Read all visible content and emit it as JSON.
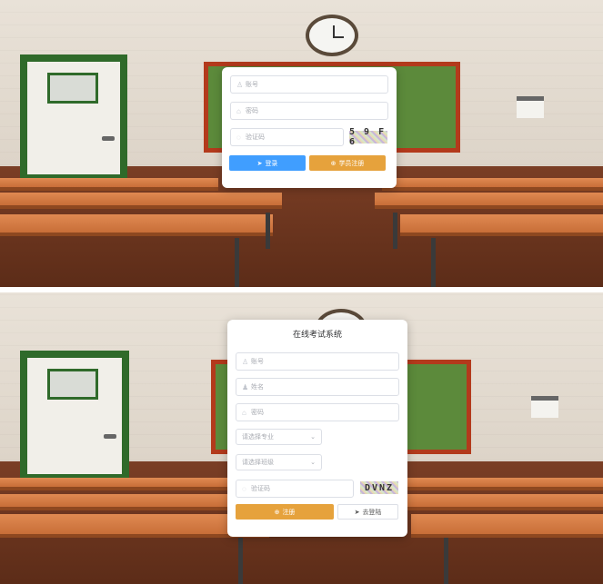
{
  "login": {
    "account_placeholder": "账号",
    "password_placeholder": "密码",
    "captcha_placeholder": "验证码",
    "captcha_text": "5 9 F 6",
    "login_button": "登录",
    "register_button": "学员注册",
    "icons": {
      "account": "user-icon",
      "password": "lock-icon",
      "captcha": "shield-icon",
      "login": "send-icon",
      "register": "plus-circle-icon"
    }
  },
  "register": {
    "title": "在线考试系统",
    "account_placeholder": "账号",
    "name_placeholder": "姓名",
    "password_placeholder": "密码",
    "major_placeholder": "请选择专业",
    "class_placeholder": "请选择班级",
    "captcha_placeholder": "验证码",
    "captcha_text": "DVNZ",
    "register_button": "注册",
    "back_button": "去登陆",
    "icons": {
      "account": "user-icon",
      "name": "person-icon",
      "password": "lock-icon",
      "captcha": "shield-icon",
      "register": "plus-circle-icon",
      "back": "send-icon"
    }
  },
  "colors": {
    "primary": "#409eff",
    "warning": "#e6a23c",
    "border": "#dcdfe6",
    "placeholder": "#a8abb2"
  }
}
